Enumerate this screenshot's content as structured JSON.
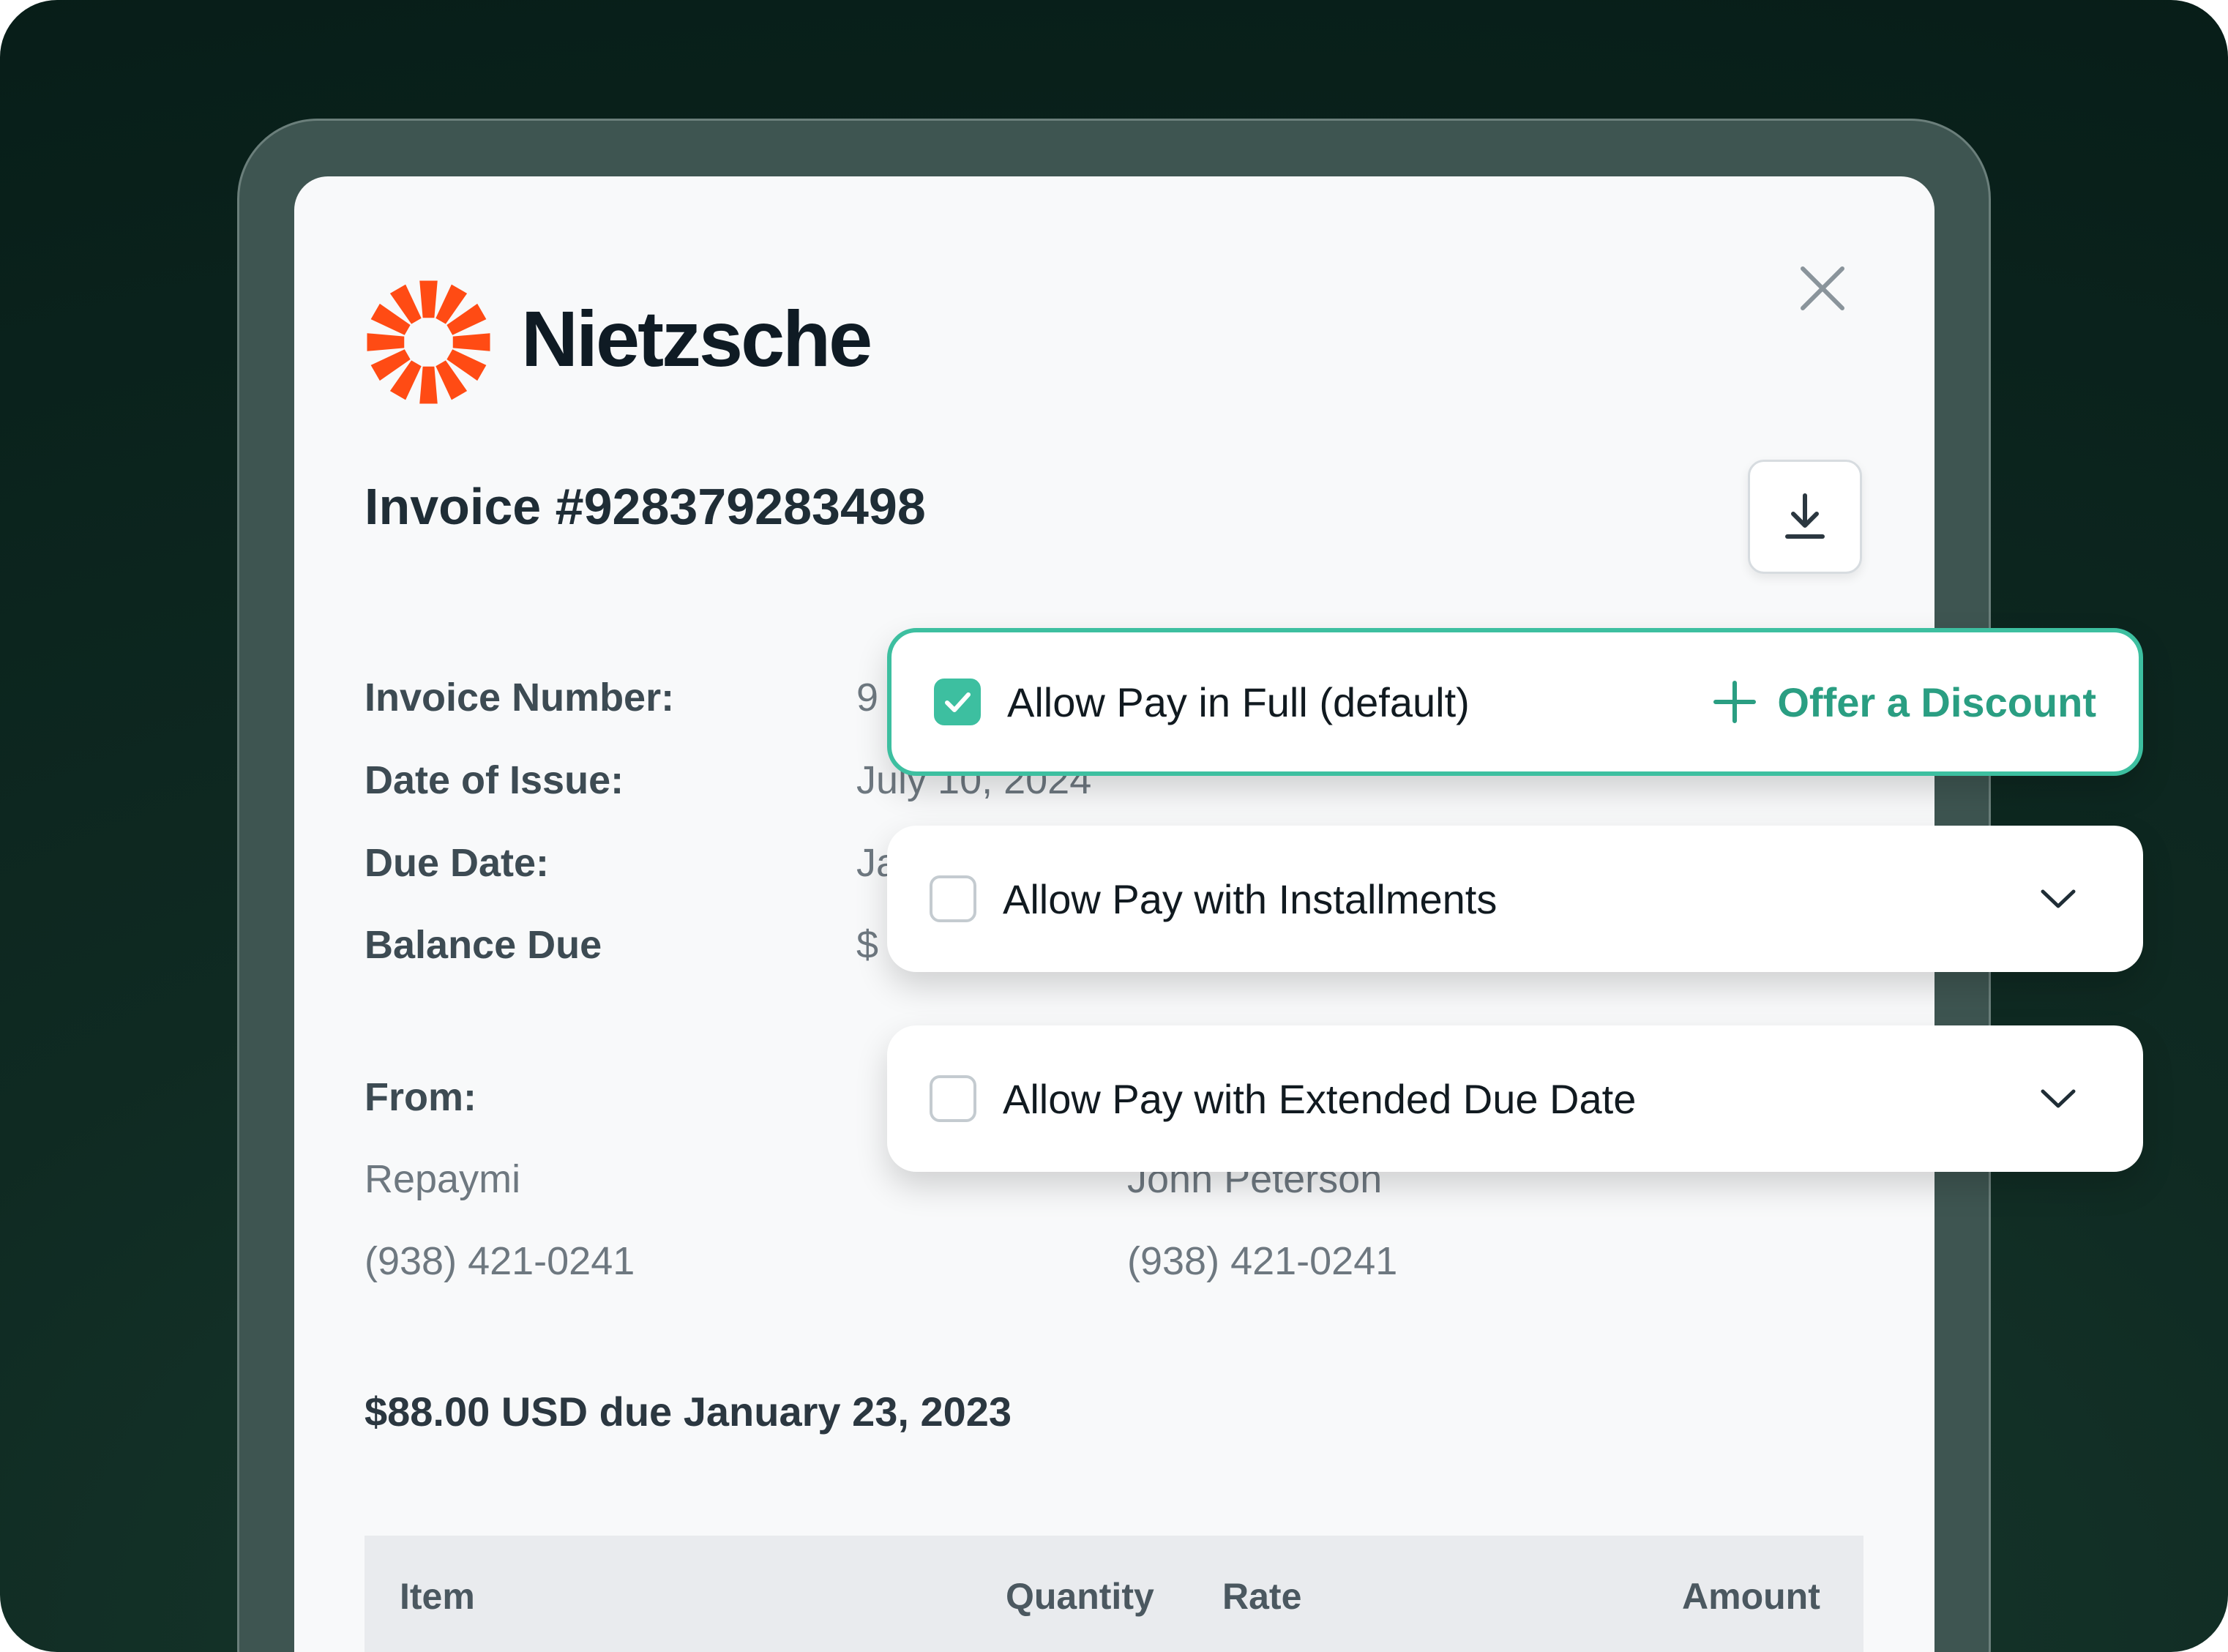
{
  "brand": {
    "name": "Nietzsche",
    "logo_icon": "sunburst-logo-icon",
    "accent": "#ff4b14"
  },
  "invoice": {
    "title": "Invoice #928379283498",
    "fields": [
      {
        "label": "Invoice Number:",
        "value": "9"
      },
      {
        "label": "Date of Issue:",
        "value": "July 10, 2024"
      },
      {
        "label": "Due Date:",
        "value": "Ja"
      },
      {
        "label": "Balance Due",
        "value": "$"
      }
    ],
    "from": {
      "label": "From:",
      "name": "Repaymi",
      "phone": "(938) 421-0241"
    },
    "to": {
      "name": "John Peterson",
      "phone": "(938) 421-0241"
    },
    "summary": "$88.00 USD due January 23, 2023",
    "table_headers": [
      "Item",
      "Quantity",
      "Rate",
      "Amount"
    ]
  },
  "options": [
    {
      "label": "Allow Pay in Full (default)",
      "checked": true,
      "action": "Offer a Discount"
    },
    {
      "label": "Allow Pay with Installments",
      "checked": false
    },
    {
      "label": "Allow Pay with Extended Due Date",
      "checked": false
    }
  ],
  "colors": {
    "accent_green": "#3dbfa0",
    "discount_text": "#2a9e82",
    "background": "#0f2a22"
  }
}
